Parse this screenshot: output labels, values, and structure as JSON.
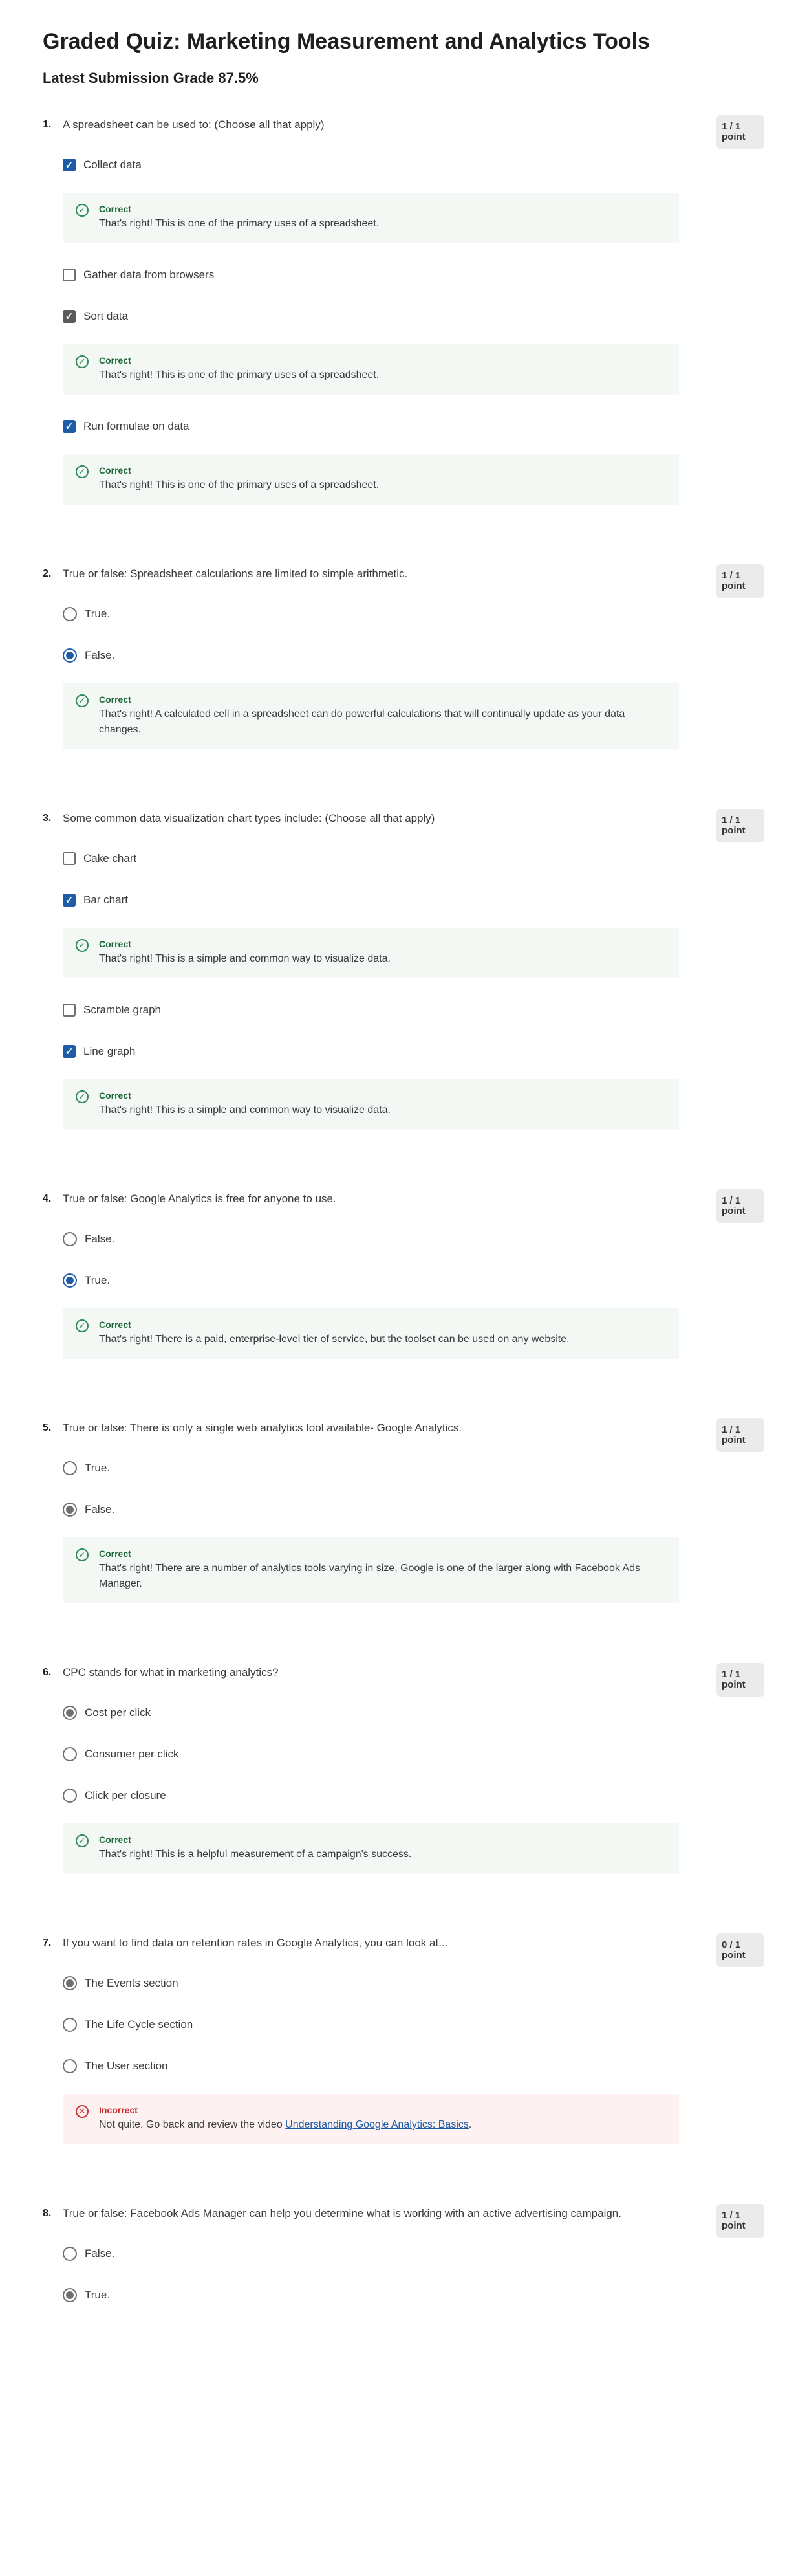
{
  "header": {
    "title": "Graded Quiz: Marketing Measurement and Analytics Tools",
    "grade": "Latest Submission Grade 87.5%"
  },
  "questions": [
    {
      "number": "1.",
      "text": "A spreadsheet can be used to: (Choose all that apply)",
      "points": "1 / 1 point",
      "type": "checkbox",
      "options": [
        {
          "label": "Collect data",
          "checked": true,
          "style": "blue",
          "feedback": {
            "title": "Correct",
            "text": "That's right! This is one of the primary uses of a spreadsheet."
          }
        },
        {
          "label": "Gather data from browsers",
          "checked": false
        },
        {
          "label": "Sort data",
          "checked": true,
          "style": "gray",
          "feedback": {
            "title": "Correct",
            "text": "That's right! This is one of the primary uses of a spreadsheet."
          }
        },
        {
          "label": "Run formulae on data",
          "checked": true,
          "style": "blue",
          "feedback": {
            "title": "Correct",
            "text": "That's right! This is one of the primary uses of a spreadsheet."
          }
        }
      ]
    },
    {
      "number": "2.",
      "text": "True or false: Spreadsheet calculations are limited to simple arithmetic.",
      "points": "1 / 1 point",
      "type": "radio",
      "options": [
        {
          "label": "True.",
          "checked": false
        },
        {
          "label": "False.",
          "checked": true,
          "style": "blue"
        }
      ],
      "feedback": {
        "title": "Correct",
        "text": "That's right! A calculated cell in a spreadsheet can do powerful calculations that will continually update as your data changes."
      }
    },
    {
      "number": "3.",
      "text": "Some common data visualization chart types include: (Choose all that apply)",
      "points": "1 / 1 point",
      "type": "checkbox",
      "options": [
        {
          "label": "Cake chart",
          "checked": false
        },
        {
          "label": "Bar chart",
          "checked": true,
          "style": "blue",
          "feedback": {
            "title": "Correct",
            "text": "That's right! This is a simple and common way to visualize data."
          }
        },
        {
          "label": "Scramble graph",
          "checked": false
        },
        {
          "label": "Line graph",
          "checked": true,
          "style": "blue",
          "feedback": {
            "title": "Correct",
            "text": "That's right! This is a simple and common way to visualize data."
          }
        }
      ]
    },
    {
      "number": "4.",
      "text": "True or false: Google Analytics is free for anyone to use.",
      "points": "1 / 1 point",
      "type": "radio",
      "options": [
        {
          "label": "False.",
          "checked": false
        },
        {
          "label": "True.",
          "checked": true,
          "style": "blue"
        }
      ],
      "feedback": {
        "title": "Correct",
        "text": "That's right! There is a paid, enterprise-level tier of service, but the toolset can be used on any website."
      }
    },
    {
      "number": "5.",
      "text": "True or false: There is only a single web analytics tool available- Google Analytics.",
      "points": "1 / 1 point",
      "type": "radio",
      "options": [
        {
          "label": "True.",
          "checked": false
        },
        {
          "label": "False.",
          "checked": true,
          "style": "gray"
        }
      ],
      "feedback": {
        "title": "Correct",
        "text": "That's right! There are a number of analytics tools varying in size, Google is one of the larger along with Facebook Ads Manager."
      }
    },
    {
      "number": "6.",
      "text": "CPC stands for what in marketing analytics?",
      "points": "1 / 1 point",
      "type": "radio",
      "options": [
        {
          "label": "Cost per click",
          "checked": true,
          "style": "gray"
        },
        {
          "label": "Consumer per click",
          "checked": false
        },
        {
          "label": "Click per closure",
          "checked": false
        }
      ],
      "feedback": {
        "title": "Correct",
        "text": "That's right! This is a helpful measurement of a campaign's success."
      }
    },
    {
      "number": "7.",
      "text": "If you want to find data on retention rates in Google Analytics, you can look at...",
      "points": "0 / 1 point",
      "type": "radio",
      "options": [
        {
          "label": "The Events section",
          "checked": true,
          "style": "gray"
        },
        {
          "label": "The Life Cycle section",
          "checked": false
        },
        {
          "label": "The User section",
          "checked": false
        }
      ],
      "feedback": {
        "title": "Incorrect",
        "bad": true,
        "text": "Not quite. Go back and review the video ",
        "link": "Understanding Google Analytics: Basics",
        "after": "."
      }
    },
    {
      "number": "8.",
      "text": "True or false: Facebook Ads Manager can help you determine what is working with an active advertising campaign.",
      "points": "1 / 1 point",
      "type": "radio",
      "options": [
        {
          "label": "False.",
          "checked": false
        },
        {
          "label": "True.",
          "checked": true,
          "style": "gray"
        }
      ]
    }
  ],
  "icons": {
    "correct": "check-circle-icon",
    "incorrect": "x-circle-icon",
    "checkbox_tick": "checkmark-icon"
  },
  "colors": {
    "accent": "#1f5ca8",
    "correct": "#1e6b3a",
    "incorrect": "#c62828",
    "feedback_bg": "#f4f8f5",
    "feedback_bad_bg": "#fdf1f1"
  }
}
